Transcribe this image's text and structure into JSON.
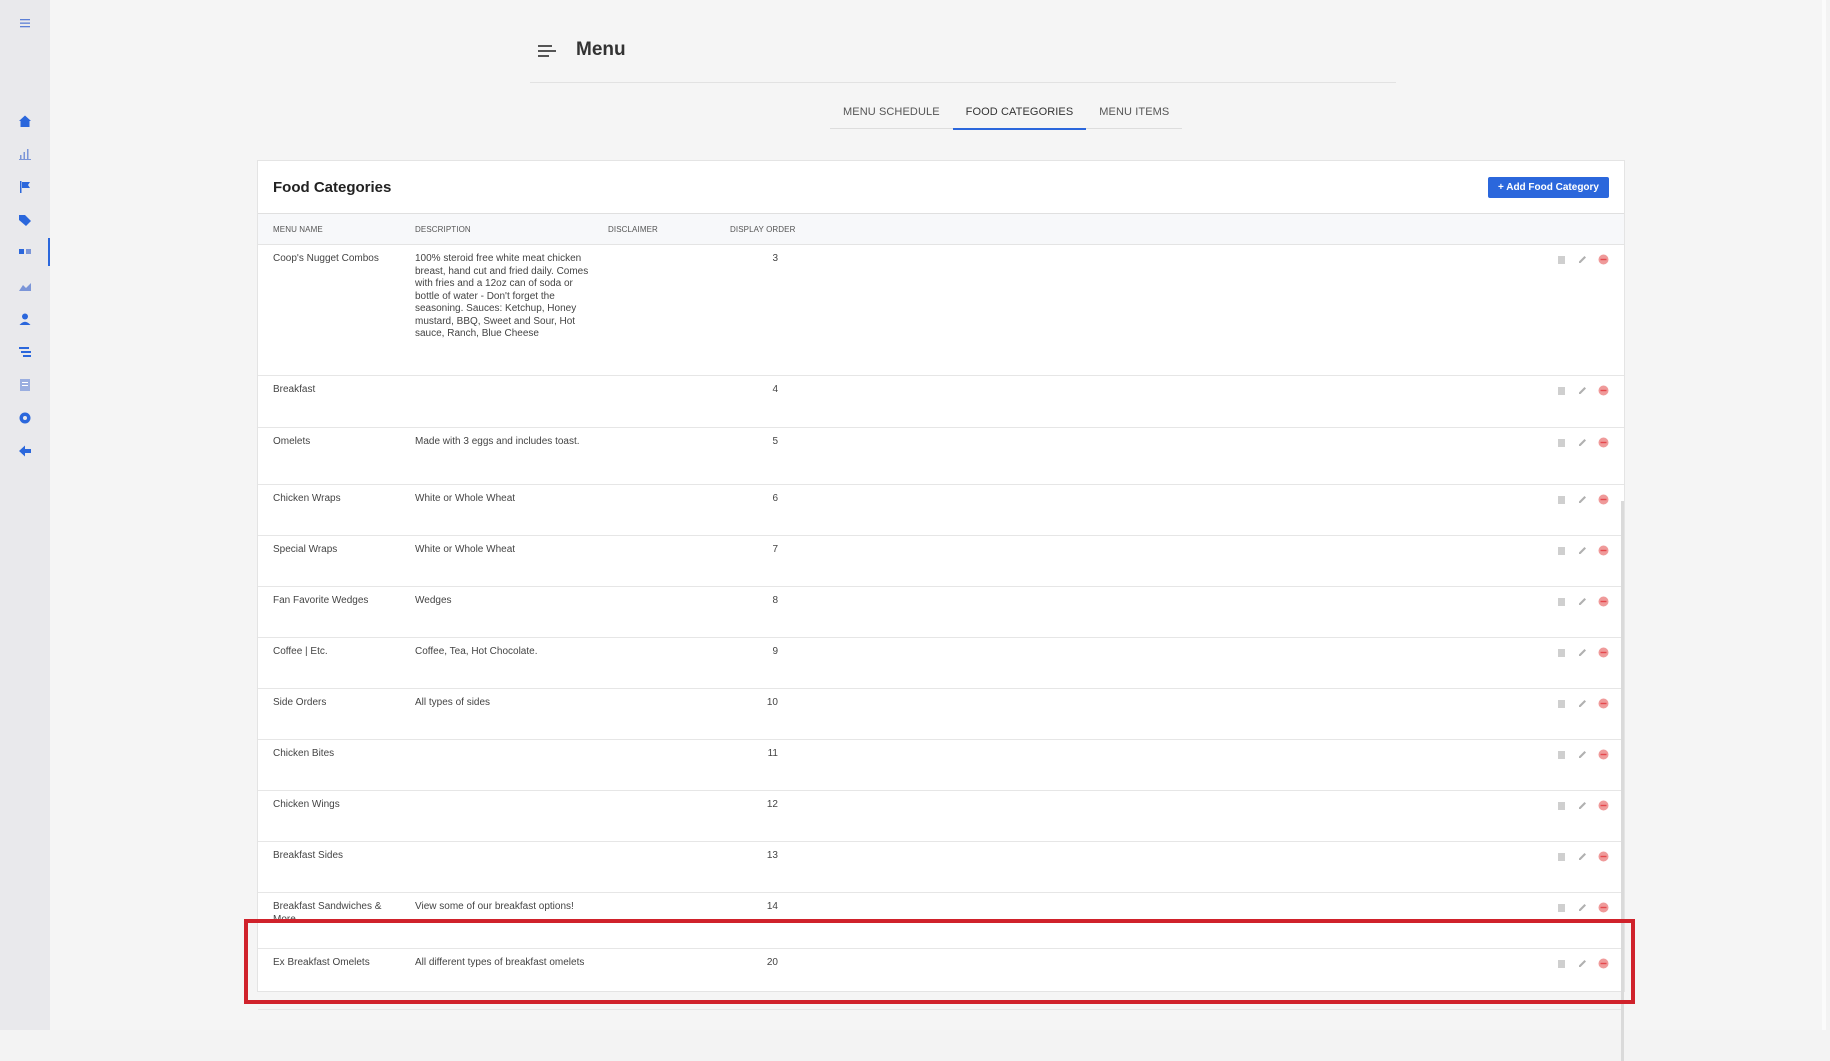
{
  "header": {
    "title": "Menu"
  },
  "tabs": [
    {
      "label": "MENU SCHEDULE"
    },
    {
      "label": "FOOD CATEGORIES"
    },
    {
      "label": "MENU ITEMS"
    }
  ],
  "card": {
    "title": "Food Categories",
    "add_button": "+ Add Food Category",
    "columns": {
      "name": "MENU NAME",
      "description": "DESCRIPTION",
      "disclaimer": "DISCLAIMER",
      "order": "DISPLAY ORDER"
    }
  },
  "rows": [
    {
      "name": "Coop's Nugget Combos",
      "description": "100% steroid free white meat chicken breast, hand cut and fried daily. Comes with fries and a 12oz can of soda or bottle of water - Don't forget the seasoning. Sauces: Ketchup, Honey mustard, BBQ, Sweet and Sour, Hot sauce, Ranch, Blue Cheese",
      "order": "3"
    },
    {
      "name": "Breakfast",
      "description": "",
      "order": "4"
    },
    {
      "name": "Omelets",
      "description": "Made with 3 eggs and includes toast.",
      "order": "5"
    },
    {
      "name": "Chicken Wraps",
      "description": "White or Whole Wheat",
      "order": "6"
    },
    {
      "name": "Special Wraps",
      "description": "White or Whole Wheat",
      "order": "7"
    },
    {
      "name": "Fan Favorite Wedges",
      "description": "Wedges",
      "order": "8"
    },
    {
      "name": "Coffee | Etc.",
      "description": "Coffee, Tea, Hot Chocolate.",
      "order": "9"
    },
    {
      "name": "Side Orders",
      "description": "All types of sides",
      "order": "10"
    },
    {
      "name": "Chicken Bites",
      "description": "",
      "order": "11"
    },
    {
      "name": "Chicken Wings",
      "description": "",
      "order": "12"
    },
    {
      "name": "Breakfast Sides",
      "description": "",
      "order": "13"
    },
    {
      "name": "Breakfast Sandwiches & More",
      "description": "View some of our breakfast options!",
      "order": "14"
    },
    {
      "name": "Ex Breakfast Omelets",
      "description": "All different types of breakfast omelets",
      "order": "20"
    }
  ],
  "colors": {
    "accent": "#2b67dc",
    "danger": "#e5484d",
    "highlight": "#d0222b"
  },
  "sidebar_icons": [
    "menu-icon",
    "home-icon",
    "chart-icon",
    "flag-icon",
    "tag-icon",
    "list-icon",
    "report-icon",
    "user-icon",
    "tree-icon",
    "document-icon",
    "gear-icon",
    "back-arrow-icon"
  ]
}
